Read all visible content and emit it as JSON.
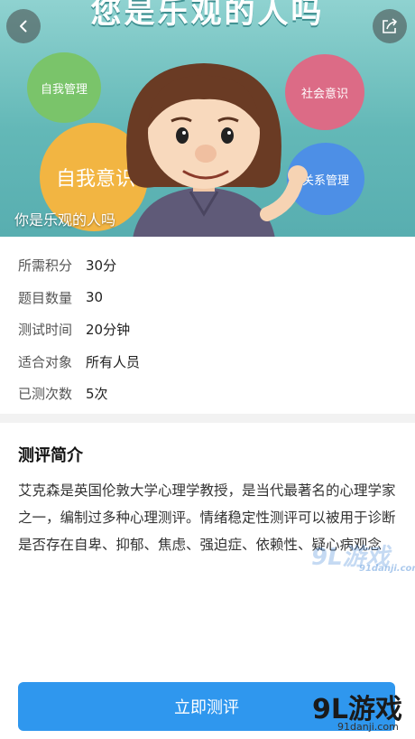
{
  "hero": {
    "title": "您是乐观的人吗",
    "caption": "你是乐观的人吗",
    "bubbles": {
      "self_management": "自我管理",
      "social_awareness": "社会意识",
      "self_awareness": "自我意识",
      "relationship_management": "关系管理"
    }
  },
  "info": [
    {
      "label": "所需积分",
      "value": "30分"
    },
    {
      "label": "题目数量",
      "value": "30"
    },
    {
      "label": "测试时间",
      "value": "20分钟"
    },
    {
      "label": "适合对象",
      "value": "所有人员"
    },
    {
      "label": "已测次数",
      "value": "5次"
    }
  ],
  "intro": {
    "title": "测评简介",
    "text": "艾克森是英国伦敦大学心理学教授，是当代最著名的心理学家之一，编制过多种心理测评。情绪稳定性测评可以被用于诊断是否存在自卑、抑郁、焦虑、强迫症、依赖性、疑心病观念"
  },
  "action": {
    "start_label": "立即测评"
  },
  "watermark": {
    "brand": "9L游戏",
    "domain": "91danji.com"
  },
  "icons": {
    "back": "chevron-left-icon",
    "share": "share-icon"
  },
  "colors": {
    "accent": "#2f97ee",
    "hero_bg": "#63b8b7"
  }
}
